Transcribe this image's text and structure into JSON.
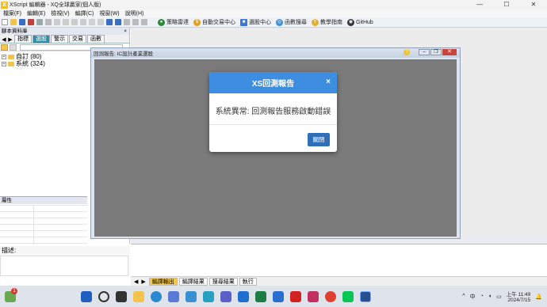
{
  "window": {
    "title": "XScript 編輯器 - XQ全球贏家(個人版)",
    "controls": [
      "—",
      "☐",
      "✕"
    ]
  },
  "menu": [
    "檔案(F)",
    "編輯(E)",
    "檢視(V)",
    "編譯(C)",
    "視窗(W)",
    "說明(H)"
  ],
  "toolbar": {
    "links": [
      {
        "label": "策略雷達",
        "color": "#2a8a3a",
        "glyph": "●"
      },
      {
        "label": "自動交易中心",
        "color": "#e0a020",
        "glyph": "$"
      },
      {
        "label": "選股中心",
        "color": "#3a7ad0",
        "glyph": "■"
      },
      {
        "label": "函數搜尋",
        "color": "#3a8fd0",
        "glyph": "◎"
      },
      {
        "label": "教學指南",
        "color": "#e0b030",
        "glyph": "Y"
      },
      {
        "label": "GitHub",
        "color": "#333333",
        "glyph": "◉"
      }
    ]
  },
  "left_panel": {
    "title": "腳本資料庫",
    "close": "×",
    "tabs": [
      "指標",
      "選股",
      "警示",
      "交易",
      "函數"
    ],
    "active_tab": "選股",
    "tree": [
      {
        "label": "自訂 (80)"
      },
      {
        "label": "系統 (324)"
      }
    ],
    "properties_title": "屬性",
    "description_label": "描述:"
  },
  "mdi_window": {
    "title": "回測報告: IC設計產業選股",
    "help": "?"
  },
  "dialog": {
    "title": "XS回測報告",
    "close": "×",
    "message": "系統異常: 回測報告服務啟動錯誤",
    "button": "關閉"
  },
  "bottom_tabs": [
    "編譯輸出",
    "編譯結果",
    "搜尋結果",
    "執行"
  ],
  "active_bottom_tab": "編譯輸出",
  "taskbar": {
    "notification_badge": "1",
    "tray": [
      "^",
      "中"
    ],
    "time": "上午 11:49",
    "date": "2024/7/15"
  }
}
